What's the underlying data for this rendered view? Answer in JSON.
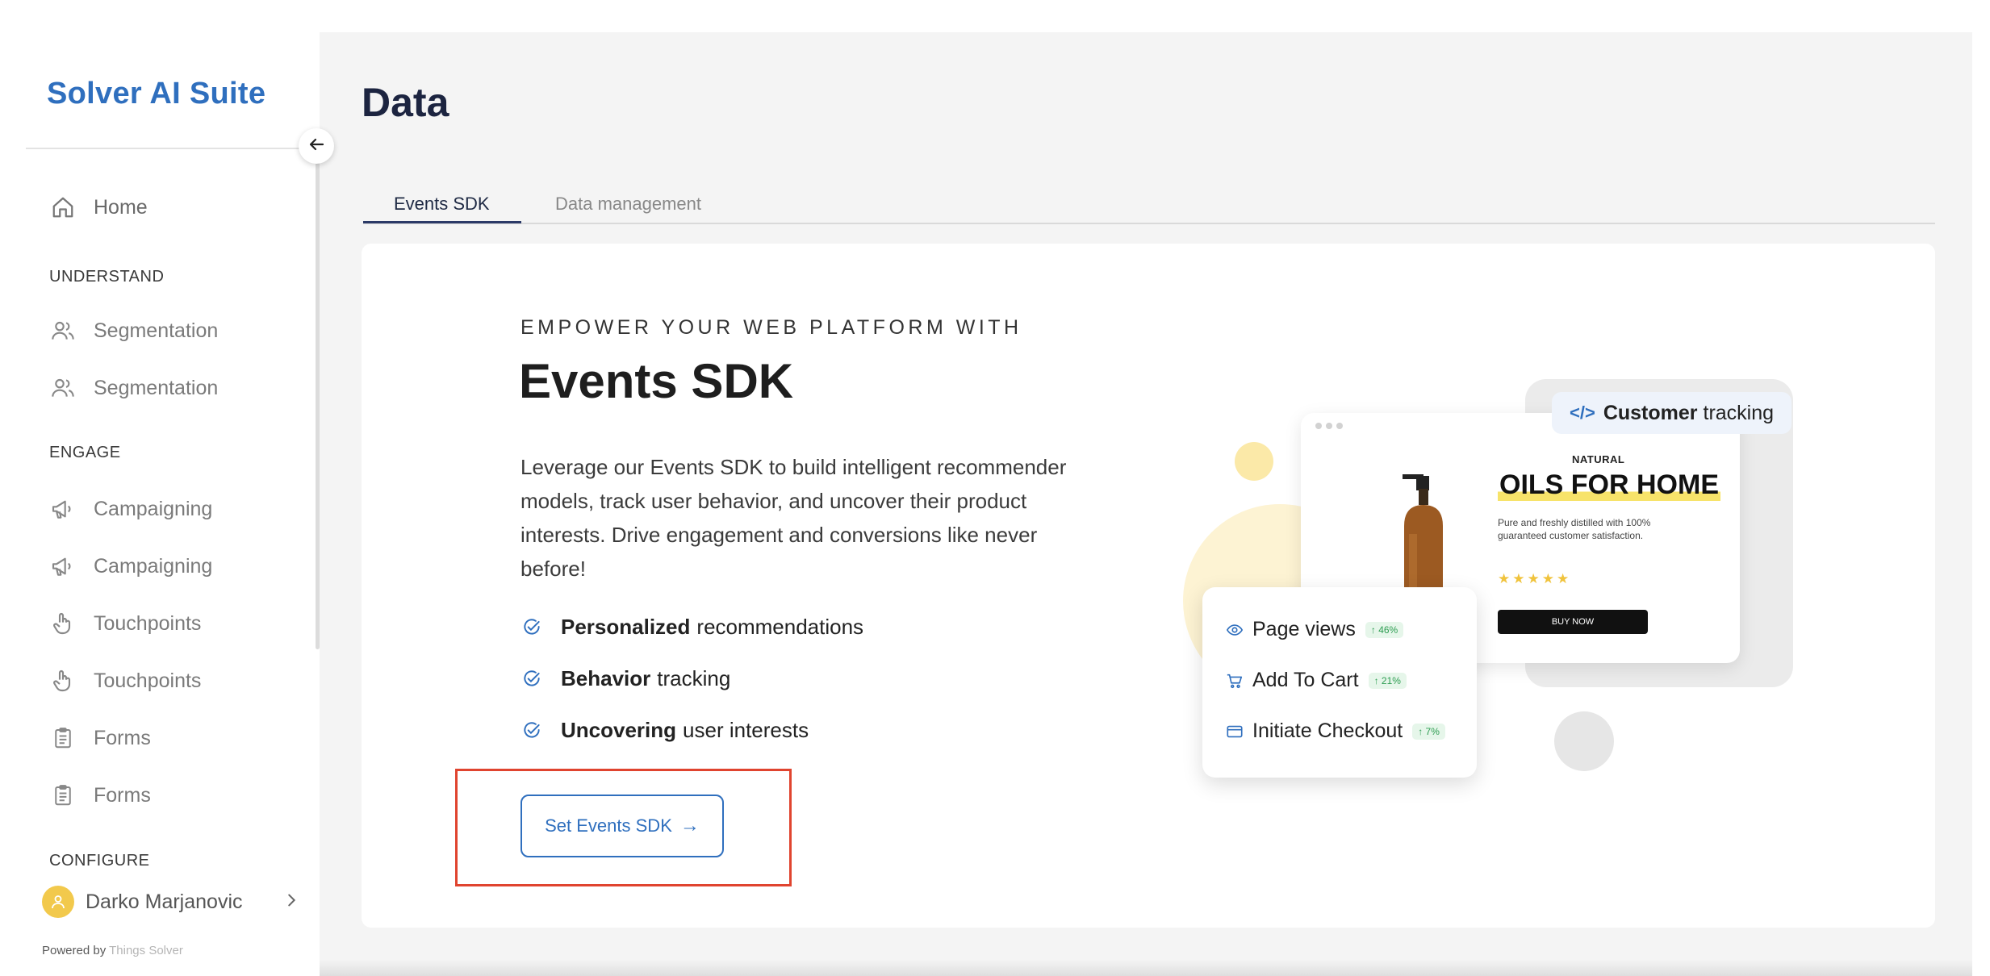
{
  "sidebar": {
    "brand": "Solver AI Suite",
    "home_label": "Home",
    "sections": {
      "understand": "UNDERSTAND",
      "engage": "ENGAGE",
      "configure": "CONFIGURE"
    },
    "items": [
      {
        "label": "Segmentation",
        "icon": "users-icon"
      },
      {
        "label": "Segmentation",
        "icon": "users-icon"
      },
      {
        "label": "Campaigning",
        "icon": "megaphone-icon"
      },
      {
        "label": "Campaigning",
        "icon": "megaphone-icon"
      },
      {
        "label": "Touchpoints",
        "icon": "pointer-hand-icon"
      },
      {
        "label": "Touchpoints",
        "icon": "pointer-hand-icon"
      },
      {
        "label": "Forms",
        "icon": "clipboard-icon"
      },
      {
        "label": "Forms",
        "icon": "clipboard-icon"
      }
    ],
    "user_name": "Darko Marjanovic",
    "powered_prefix": "Powered by",
    "powered_brand": "Things Solver"
  },
  "page": {
    "title": "Data",
    "tabs": [
      {
        "label": "Events SDK",
        "active": true
      },
      {
        "label": "Data management",
        "active": false
      }
    ]
  },
  "hero": {
    "eyebrow": "EMPOWER YOUR WEB PLATFORM WITH",
    "title": "Events SDK",
    "description": "Leverage our Events SDK to build intelligent recommender models, track user behavior, and uncover their product interests. Drive engagement and conversions like never before!",
    "bullets": [
      {
        "bold": "Personalized",
        "rest": "recommendations"
      },
      {
        "bold": "Behavior",
        "rest": "tracking"
      },
      {
        "bold": "Uncovering",
        "rest": "user interests"
      }
    ],
    "cta_label": "Set Events SDK",
    "cta_arrow": "→"
  },
  "illustration": {
    "chip_bold": "Customer",
    "chip_rest": "tracking",
    "product": {
      "natural": "NATURAL",
      "headline": "OILS FOR HOME",
      "text": "Pure and freshly distilled with 100% guaranteed customer satisfaction.",
      "stars": "★★★★★",
      "button": "BUY NOW"
    },
    "metrics": [
      {
        "label": "Page views",
        "change": "↑ 46%"
      },
      {
        "label": "Add To Cart",
        "change": "↑ 21%"
      },
      {
        "label": "Initiate Checkout",
        "change": "↑ 7%"
      }
    ]
  },
  "colors": {
    "brand": "#2f6fbe",
    "title": "#1c2440",
    "highlight": "#e0442f",
    "avatar": "#f2c94c"
  }
}
